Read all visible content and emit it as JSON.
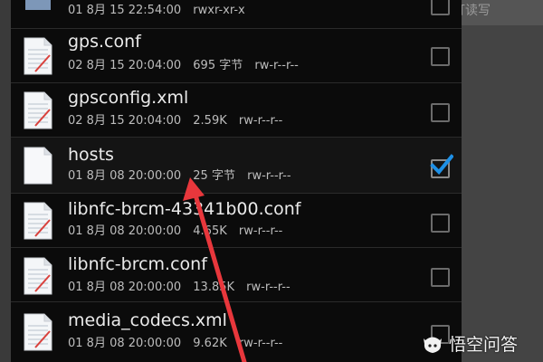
{
  "header_hint": "打读写",
  "files": [
    {
      "name": "",
      "date": "01 8月 15 22:54:00",
      "size": "",
      "perm": "rwxr-xr-x",
      "type": "folder",
      "checked": false
    },
    {
      "name": "gps.conf",
      "date": "02 8月 15 20:04:00",
      "size": "695 字节",
      "perm": "rw-r--r--",
      "type": "file",
      "checked": false
    },
    {
      "name": "gpsconfig.xml",
      "date": "02 8月 15 20:04:00",
      "size": "2.59K",
      "perm": "rw-r--r--",
      "type": "file",
      "checked": false
    },
    {
      "name": "hosts",
      "date": "01 8月 08 20:00:00",
      "size": "25 字节",
      "perm": "rw-r--r--",
      "type": "file-plain",
      "checked": true
    },
    {
      "name": "libnfc-brcm-43341b00.conf",
      "date": "01 8月 08 20:00:00",
      "size": "4.65K",
      "perm": "rw-r--r--",
      "type": "file",
      "checked": false
    },
    {
      "name": "libnfc-brcm.conf",
      "date": "01 8月 08 20:00:00",
      "size": "13.85K",
      "perm": "rw-r--r--",
      "type": "file",
      "checked": false
    },
    {
      "name": "media_codecs.xml",
      "date": "01 8月 08 20:00:00",
      "size": "9.62K",
      "perm": "rw-r--r--",
      "type": "file",
      "checked": false
    }
  ],
  "watermark": {
    "text": "悟空问答"
  },
  "colors": {
    "accent": "#1e90e6",
    "arrow": "#e8373c",
    "row_border": "#2b2b2b"
  }
}
